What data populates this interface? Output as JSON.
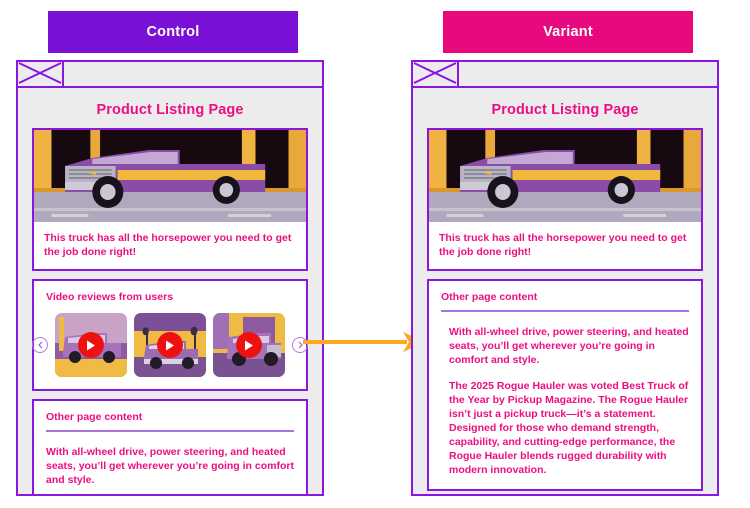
{
  "colors": {
    "control_badge": "#7A0FD6",
    "variant_badge": "#E8097E",
    "frame_border": "#8B16E0",
    "text_pink": "#ED0E83",
    "arrow": "#FFA81E",
    "divider": "#a972e4",
    "play_button": "#EE1111",
    "viewport_bg": "#ececec"
  },
  "control": {
    "badge_label": "Control",
    "browser": {
      "tab_placeholder_icon": "crossed-box-icon"
    },
    "page_title": "Product Listing Page",
    "hero": {
      "image_alt": "purple-and-gold-pickup-truck-illustration",
      "caption": "This truck has all the horsepower you need to get the job done right!"
    },
    "video_card": {
      "heading": "Video reviews from users",
      "prev_icon": "chevron-left-icon",
      "next_icon": "chevron-right-icon",
      "thumbnails": [
        {
          "alt": "truck-at-sunset-thumbnail",
          "play_icon": "play-icon"
        },
        {
          "alt": "truck-with-palm-trees-thumbnail",
          "play_icon": "play-icon"
        },
        {
          "alt": "truck-in-front-of-building-thumbnail",
          "play_icon": "play-icon"
        }
      ]
    },
    "other_card": {
      "heading": "Other page content",
      "paragraphs": [
        "With all-wheel drive, power steering, and heated seats, you’ll get wherever you’re going in comfort and style."
      ]
    }
  },
  "variant": {
    "badge_label": "Variant",
    "browser": {
      "tab_placeholder_icon": "crossed-box-icon"
    },
    "page_title": "Product Listing Page",
    "hero": {
      "image_alt": "purple-and-gold-pickup-truck-illustration",
      "caption": "This truck has all the horsepower you need to get the job done right!"
    },
    "other_card": {
      "heading": "Other page content",
      "paragraphs": [
        "With all-wheel drive, power steering, and heated seats, you’ll get wherever you’re going in comfort and style.",
        "The 2025 Rogue Hauler was voted Best Truck of the Year by Pickup Magazine. The Rogue Hauler isn’t just a pickup truck—it’s a statement. Designed for those who demand strength, capability, and cutting-edge performance, the Rogue Hauler blends rugged durability with modern innovation."
      ]
    }
  },
  "flow": {
    "arrow_icon": "arrow-right-icon"
  }
}
